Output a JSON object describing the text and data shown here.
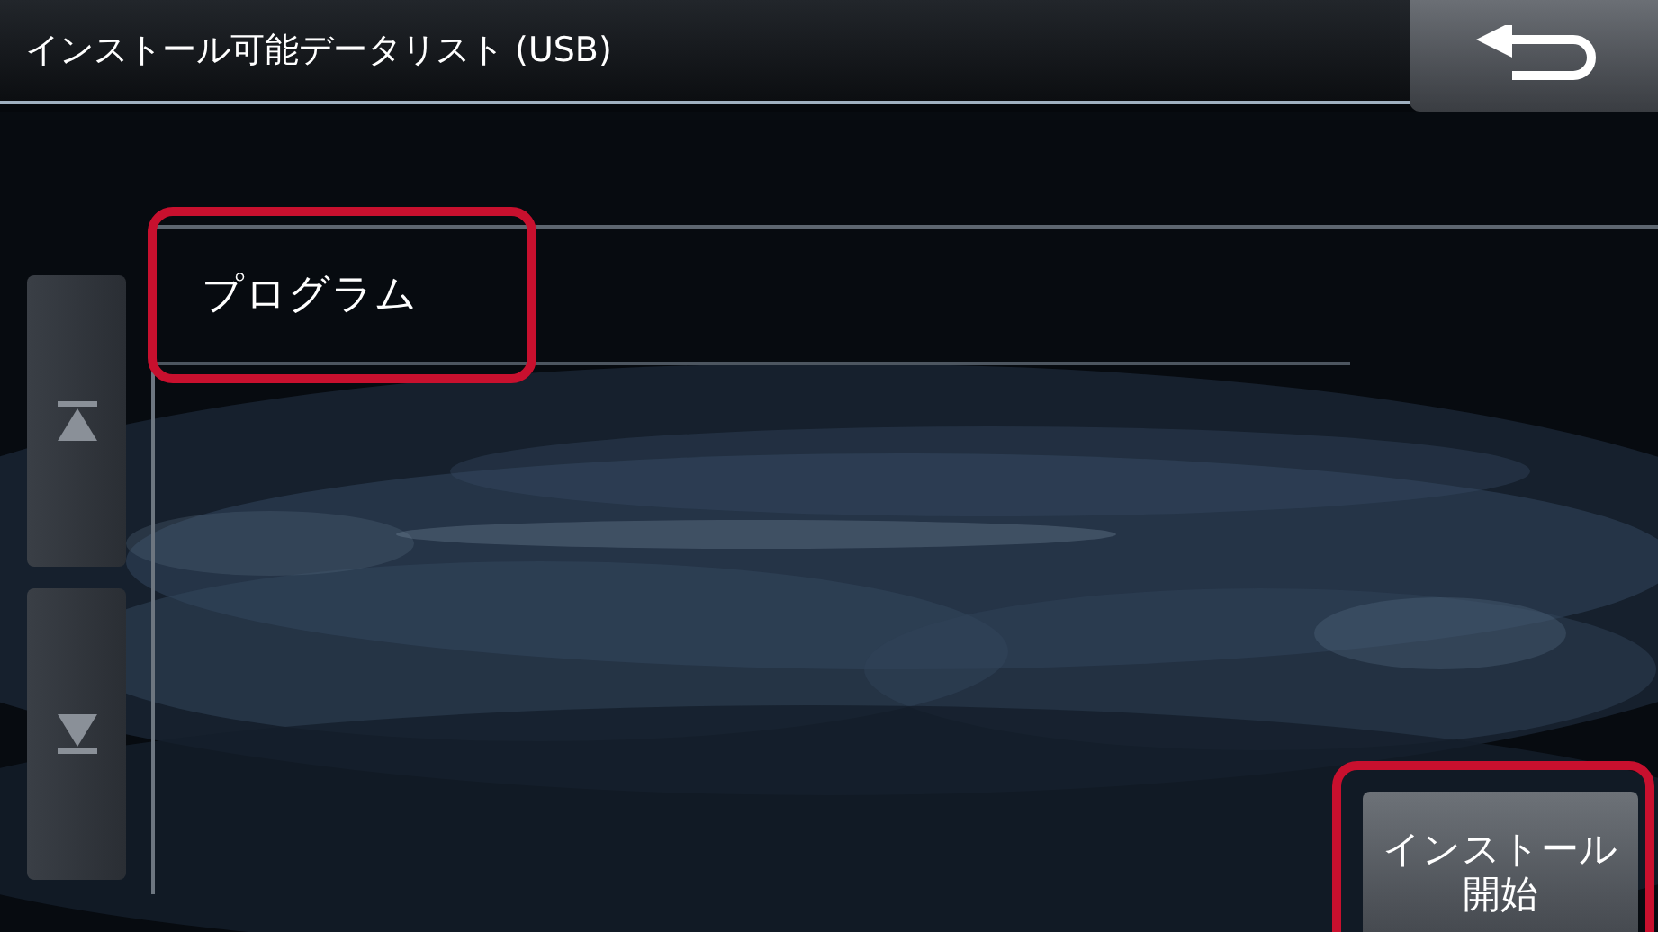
{
  "title_bar": {
    "title": "インストール可能データリスト (USB)"
  },
  "list": {
    "items": [
      {
        "label": "プログラム",
        "highlighted": true
      }
    ]
  },
  "install_button": {
    "lines": [
      "インストール",
      "開始"
    ],
    "highlighted": true
  }
}
